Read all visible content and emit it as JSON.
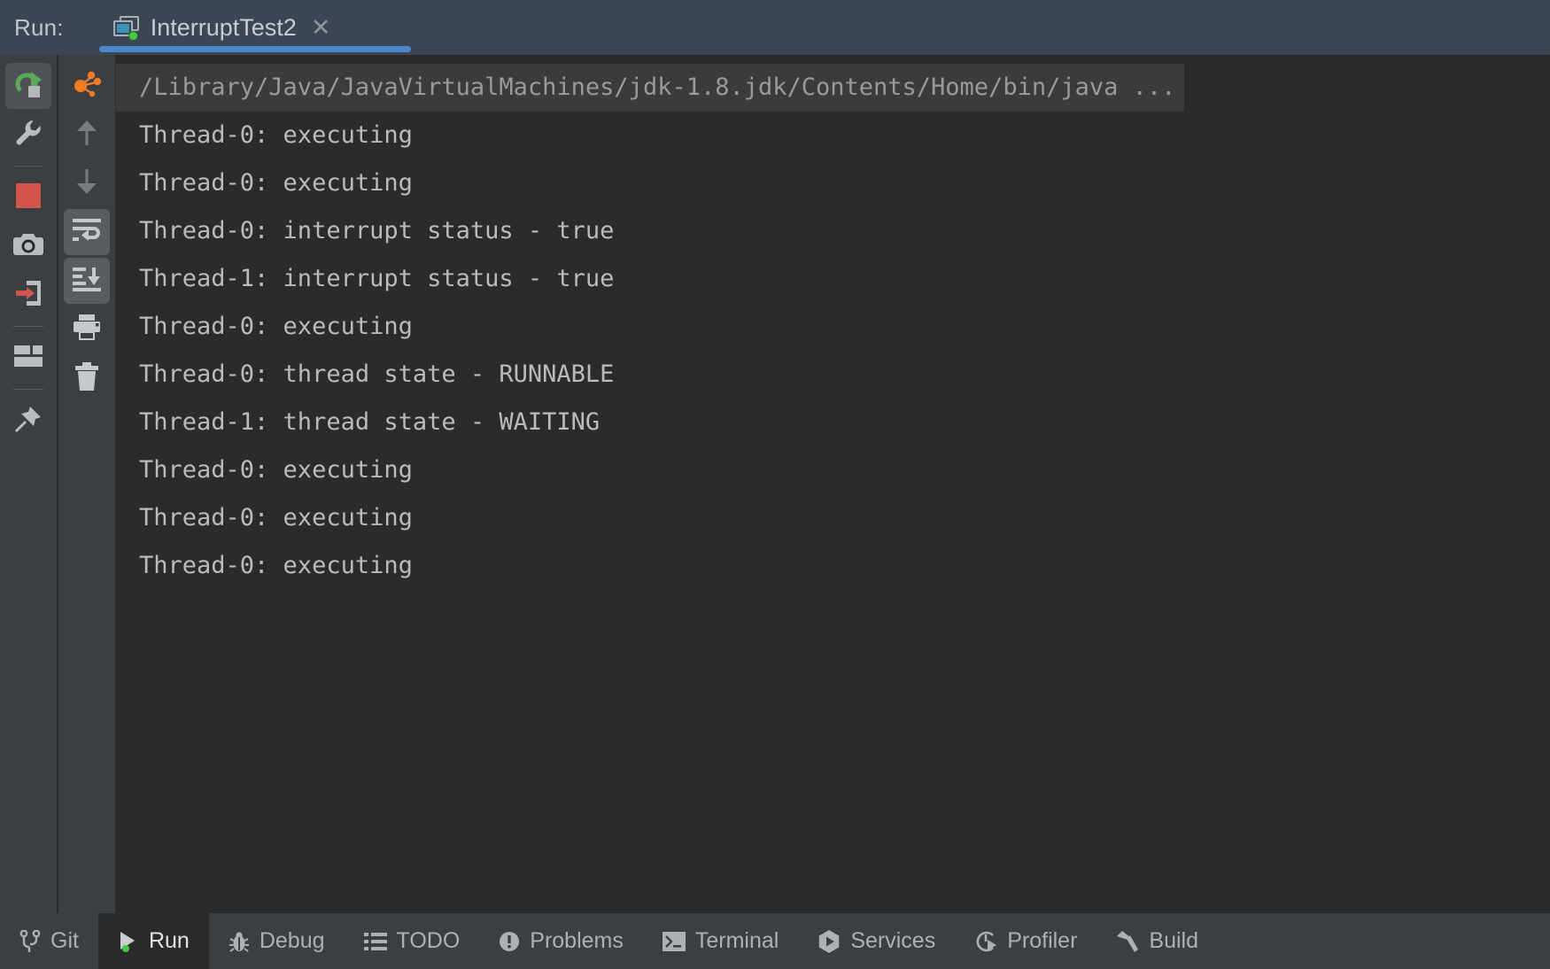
{
  "header": {
    "run_label": "Run:",
    "tab_title": "InterruptTest2",
    "tab_icon": "run-configuration-icon",
    "close_icon": "close-icon",
    "accent_color": "#4b86c8",
    "background_color": "#3c4554"
  },
  "toolbar_outer": {
    "items": [
      {
        "name": "rerun-button",
        "icon": "rerun-icon",
        "state": "active"
      },
      {
        "name": "edit-configuration-button",
        "icon": "wrench-icon",
        "state": "normal"
      },
      {
        "name": "separator-1",
        "icon": "separator",
        "state": "separator"
      },
      {
        "name": "stop-button",
        "icon": "stop-square-icon",
        "state": "normal"
      },
      {
        "name": "screenshot-button",
        "icon": "camera-icon",
        "state": "normal"
      },
      {
        "name": "attach-button",
        "icon": "import-arrow-icon",
        "state": "normal"
      },
      {
        "name": "separator-2",
        "icon": "separator",
        "state": "separator"
      },
      {
        "name": "layout-button",
        "icon": "layout-icon",
        "state": "normal"
      },
      {
        "name": "separator-3",
        "icon": "separator",
        "state": "separator"
      },
      {
        "name": "pin-tab-button",
        "icon": "pin-icon",
        "state": "normal"
      }
    ]
  },
  "toolbar_inner": {
    "items": [
      {
        "name": "thread-dump-button",
        "icon": "thread-graph-icon",
        "state": "normal"
      },
      {
        "name": "prev-occurrence-button",
        "icon": "arrow-up-icon",
        "state": "disabled"
      },
      {
        "name": "next-occurrence-button",
        "icon": "arrow-down-icon",
        "state": "disabled"
      },
      {
        "name": "soft-wrap-button",
        "icon": "soft-wrap-icon",
        "state": "toggled"
      },
      {
        "name": "scroll-to-end-button",
        "icon": "scroll-to-end-icon",
        "state": "toggled"
      },
      {
        "name": "print-button",
        "icon": "printer-icon",
        "state": "normal"
      },
      {
        "name": "clear-all-button",
        "icon": "trash-icon",
        "state": "normal"
      }
    ]
  },
  "console": {
    "command_line": "/Library/Java/JavaVirtualMachines/jdk-1.8.jdk/Contents/Home/bin/java ...",
    "lines": [
      "Thread-0: executing",
      "Thread-0: executing",
      "Thread-0: interrupt status - true",
      "Thread-1: interrupt status - true",
      "Thread-0: executing",
      "Thread-0: thread state - RUNNABLE",
      "Thread-1: thread state - WAITING",
      "Thread-0: executing",
      "Thread-0: executing",
      "Thread-0: executing"
    ],
    "background_color": "#2b2b2b",
    "text_color": "#bbbbbb"
  },
  "statusbar": {
    "items": [
      {
        "label": "Git",
        "icon": "git-branch-icon",
        "selected": false
      },
      {
        "label": "Run",
        "icon": "run-play-icon",
        "selected": true
      },
      {
        "label": "Debug",
        "icon": "bug-icon",
        "selected": false
      },
      {
        "label": "TODO",
        "icon": "todo-list-icon",
        "selected": false
      },
      {
        "label": "Problems",
        "icon": "problems-icon",
        "selected": false
      },
      {
        "label": "Terminal",
        "icon": "terminal-icon",
        "selected": false
      },
      {
        "label": "Services",
        "icon": "services-icon",
        "selected": false
      },
      {
        "label": "Profiler",
        "icon": "profiler-icon",
        "selected": false
      },
      {
        "label": "Build",
        "icon": "hammer-icon",
        "selected": false
      }
    ]
  }
}
